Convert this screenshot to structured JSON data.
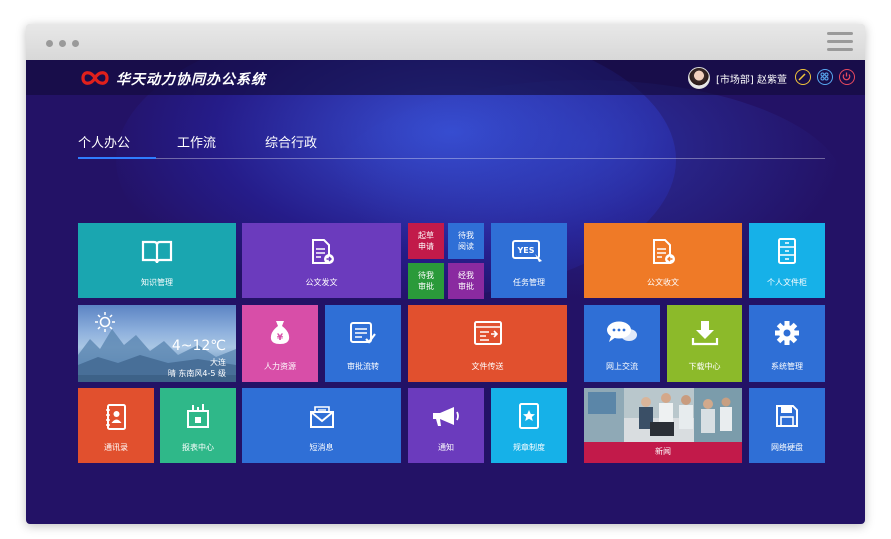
{
  "app": {
    "title": "华天动力协同办公系统"
  },
  "user": {
    "label": "[市场部] 赵紫萱"
  },
  "nav": {
    "tabs": [
      "个人办公",
      "工作流",
      "综合行政"
    ]
  },
  "weather": {
    "temp": "4~12℃",
    "city": "大连",
    "desc": "晴 东南风4-5 级"
  },
  "tiles": {
    "knowledge": "知识管理",
    "docsend": "公文发文",
    "draft": "起草申请",
    "read": "待我阅读",
    "review": "待我审批",
    "approved": "经我审批",
    "task": "任务管理",
    "docrecv": "公文收文",
    "cabinet": "个人文件柜",
    "hr": "人力资源",
    "flow": "审批流转",
    "filesend": "文件传送",
    "chat": "网上交流",
    "download": "下载中心",
    "sysadmin": "系统管理",
    "contacts": "通讯录",
    "report": "报表中心",
    "sms": "短消息",
    "notice": "通知",
    "rules": "规章制度",
    "news": "新闻",
    "disk": "网络硬盘"
  },
  "colors": {
    "background": "#231266",
    "teal": "#1aa6b0",
    "purple": "#6b3bbd",
    "blue": "#2f6fd6",
    "orange": "#ef7a27",
    "cyan": "#16b1e8",
    "red": "#e1502e",
    "green": "#2fb889",
    "lime": "#8cba2a",
    "pink": "#d84ea8",
    "crimson": "#c21a4a"
  }
}
